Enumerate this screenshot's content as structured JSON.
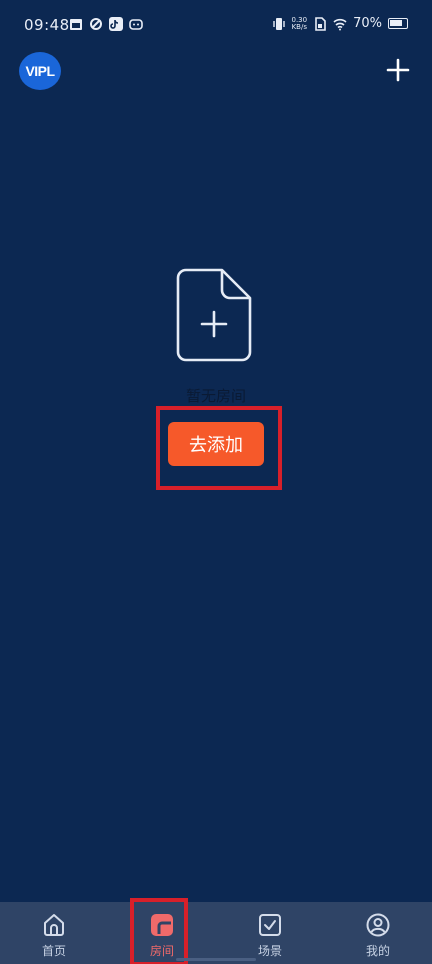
{
  "status_bar": {
    "time": "09:48",
    "net_speed_value": "0.30",
    "net_speed_unit": "KB/s",
    "battery_percent": "70%"
  },
  "header": {
    "logo_text": "VIPL",
    "add_icon": "plus-icon"
  },
  "empty_state": {
    "icon": "document-add-icon",
    "text": "暂无房间",
    "button_label": "去添加"
  },
  "bottom_nav": {
    "items": [
      {
        "label": "首页",
        "icon": "home-icon",
        "active": false
      },
      {
        "label": "房间",
        "icon": "room-icon",
        "active": true
      },
      {
        "label": "场景",
        "icon": "scene-check-icon",
        "active": false
      },
      {
        "label": "我的",
        "icon": "profile-icon",
        "active": false
      }
    ]
  },
  "colors": {
    "background": "#0c2852",
    "accent_button": "#f6592a",
    "nav_background": "#2f4466",
    "active_tab": "#ef6a6a",
    "annotation_red": "#d8202a"
  }
}
